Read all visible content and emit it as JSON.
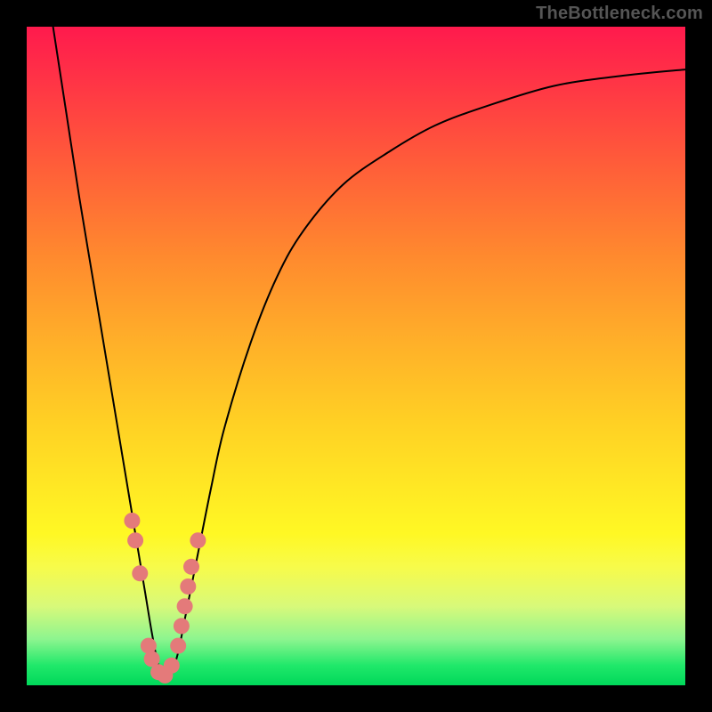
{
  "watermark": "TheBottleneck.com",
  "colors": {
    "top": "#ff1a4d",
    "mid": "#ffe824",
    "bottom": "#00d85a",
    "curve": "#000000",
    "dots": "#e47a7a",
    "frame": "#000000"
  },
  "chart_data": {
    "type": "line",
    "title": "",
    "xlabel": "",
    "ylabel": "",
    "xlim": [
      0,
      100
    ],
    "ylim": [
      0,
      100
    ],
    "grid": false,
    "legend": false,
    "series": [
      {
        "name": "bottleneck-curve",
        "x": [
          4,
          6,
          8,
          10,
          12,
          14,
          16,
          17,
          18,
          19,
          20,
          21,
          22,
          23,
          24,
          26,
          28,
          30,
          34,
          38,
          42,
          48,
          55,
          62,
          70,
          80,
          90,
          100
        ],
        "y": [
          100,
          87,
          74,
          62,
          50,
          38,
          26,
          20,
          14,
          8,
          3,
          1,
          2,
          5,
          10,
          20,
          30,
          39,
          52,
          62,
          69,
          76,
          81,
          85,
          88,
          91,
          92.5,
          93.5
        ]
      }
    ],
    "points": [
      {
        "x": 16.0,
        "y": 25
      },
      {
        "x": 16.5,
        "y": 22
      },
      {
        "x": 17.2,
        "y": 17
      },
      {
        "x": 18.5,
        "y": 6
      },
      {
        "x": 19.0,
        "y": 4
      },
      {
        "x": 20.0,
        "y": 2
      },
      {
        "x": 21.0,
        "y": 1.5
      },
      {
        "x": 22.0,
        "y": 3
      },
      {
        "x": 23.0,
        "y": 6
      },
      {
        "x": 23.5,
        "y": 9
      },
      {
        "x": 24.0,
        "y": 12
      },
      {
        "x": 24.5,
        "y": 15
      },
      {
        "x": 25.0,
        "y": 18
      },
      {
        "x": 26.0,
        "y": 22
      }
    ]
  }
}
